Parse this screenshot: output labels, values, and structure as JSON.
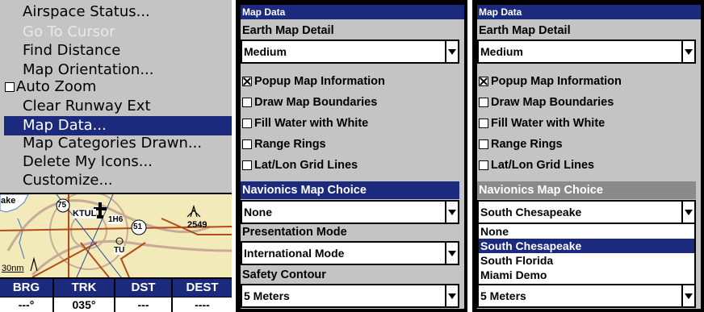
{
  "menu": {
    "items": [
      {
        "label": "Airspace Status...",
        "state": "normal"
      },
      {
        "label": "Go To Cursor",
        "state": "disabled"
      },
      {
        "label": "Find Distance",
        "state": "normal"
      },
      {
        "label": "Map Orientation...",
        "state": "normal"
      },
      {
        "label": "Auto Zoom",
        "state": "checkbox",
        "checked": false
      },
      {
        "label": "Clear Runway Ext",
        "state": "normal"
      },
      {
        "label": "Map Data...",
        "state": "selected"
      },
      {
        "label": "Map Categories Drawn...",
        "state": "normal"
      },
      {
        "label": "Delete My Icons...",
        "state": "normal"
      },
      {
        "label": "Customize...",
        "state": "normal"
      }
    ]
  },
  "map": {
    "labels": {
      "lake": "ake",
      "hwy75": "75",
      "ktul": "KTUL",
      "h1h6": "1H6",
      "hwy51": "51",
      "tu": "TU",
      "elev": "2549",
      "scale": "30nm"
    }
  },
  "status": {
    "headers": [
      "BRG",
      "TRK",
      "DST",
      "DEST"
    ],
    "values": [
      "---°",
      "035°",
      "---",
      "----"
    ]
  },
  "panel2": {
    "title": "Map Data",
    "earth_label": "Earth Map Detail",
    "earth_value": "Medium",
    "checkboxes": [
      {
        "label": "Popup Map Information",
        "checked": true
      },
      {
        "label": "Draw Map Boundaries",
        "checked": false
      },
      {
        "label": "Fill Water with White",
        "checked": false
      },
      {
        "label": "Range Rings",
        "checked": false
      },
      {
        "label": "Lat/Lon Grid Lines",
        "checked": false
      }
    ],
    "navionics_label": "Navionics Map Choice",
    "navionics_value": "None",
    "presentation_label": "Presentation Mode",
    "presentation_value": "International Mode",
    "safety_label": "Safety Contour",
    "safety_value": "5 Meters"
  },
  "panel3": {
    "title": "Map Data",
    "earth_label": "Earth Map Detail",
    "earth_value": "Medium",
    "checkboxes": [
      {
        "label": "Popup Map Information",
        "checked": true
      },
      {
        "label": "Draw Map Boundaries",
        "checked": false
      },
      {
        "label": "Fill Water with White",
        "checked": false
      },
      {
        "label": "Range Rings",
        "checked": false
      },
      {
        "label": "Lat/Lon Grid Lines",
        "checked": false
      }
    ],
    "navionics_label": "Navionics Map Choice",
    "navionics_value": "South Chesapeake",
    "options": [
      "None",
      "South Chesapeake",
      "South Florida",
      "Miami Demo"
    ],
    "selected_option": 1,
    "bottom_value": "5 Meters"
  },
  "colors": {
    "highlight": "#1b2a7c",
    "panel_bg": "#c4c4c4",
    "inactive_header": "#8a8a8a"
  }
}
